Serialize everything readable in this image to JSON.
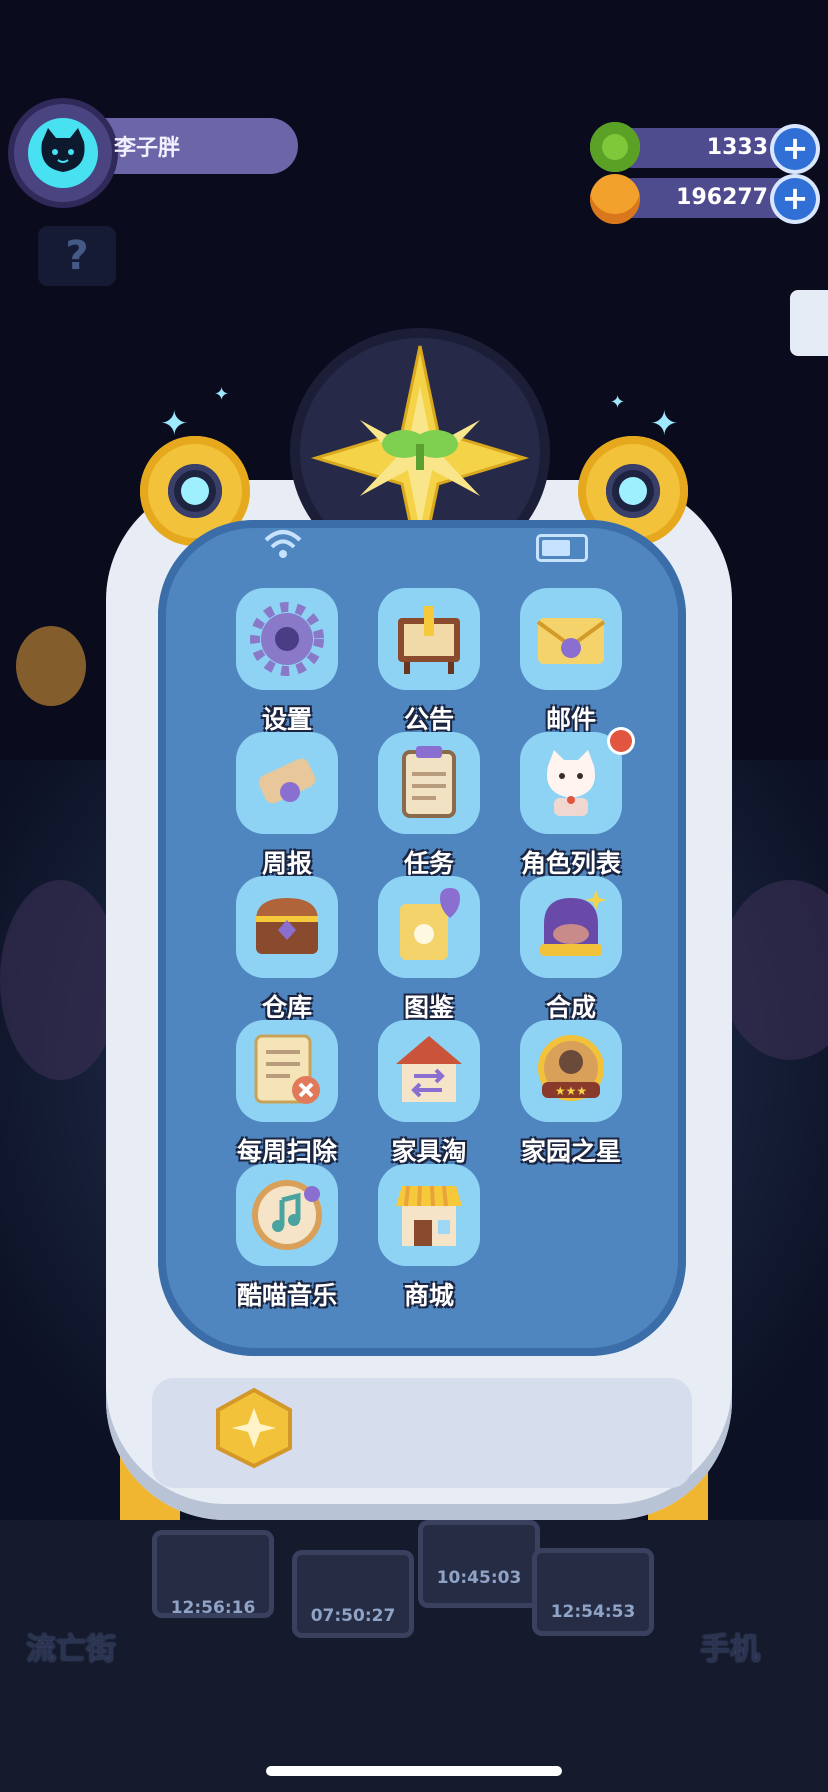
{
  "profile": {
    "name": "李子胖",
    "help_glyph": "?"
  },
  "currency": {
    "gems": {
      "value": "1333",
      "icon": "green-donut-icon",
      "color": "#7ec83a"
    },
    "coins": {
      "value": "196277",
      "icon": "planet-coin-icon",
      "color": "#f2a22c"
    },
    "plus_glyph": "+"
  },
  "apps": [
    {
      "label": "设置",
      "icon": "gear-icon"
    },
    {
      "label": "公告",
      "icon": "notice-board-icon"
    },
    {
      "label": "邮件",
      "icon": "envelope-icon"
    },
    {
      "label": "周报",
      "icon": "scroll-icon"
    },
    {
      "label": "任务",
      "icon": "clipboard-icon"
    },
    {
      "label": "角色列表",
      "icon": "cat-character-icon",
      "badge": true
    },
    {
      "label": "仓库",
      "icon": "treasure-chest-icon"
    },
    {
      "label": "图鉴",
      "icon": "book-heart-icon"
    },
    {
      "label": "合成",
      "icon": "crystal-dome-icon"
    },
    {
      "label": "每周扫除",
      "icon": "checklist-icon"
    },
    {
      "label": "家具淘",
      "icon": "house-swap-icon"
    },
    {
      "label": "家园之星",
      "icon": "star-badge-icon"
    },
    {
      "label": "酷喵音乐",
      "icon": "music-disc-icon"
    },
    {
      "label": "商城",
      "icon": "shop-icon"
    }
  ],
  "dock": {
    "left_label": "流亡街",
    "right_label": "手机",
    "timers": [
      "12:56:16",
      "07:50:27",
      "10:45:03",
      "12:54:53"
    ]
  },
  "colors": {
    "screen": "#4f86c0",
    "tile": "#8ed3f3",
    "frame": "#e7ecf5",
    "accent": "#f2c23a"
  }
}
